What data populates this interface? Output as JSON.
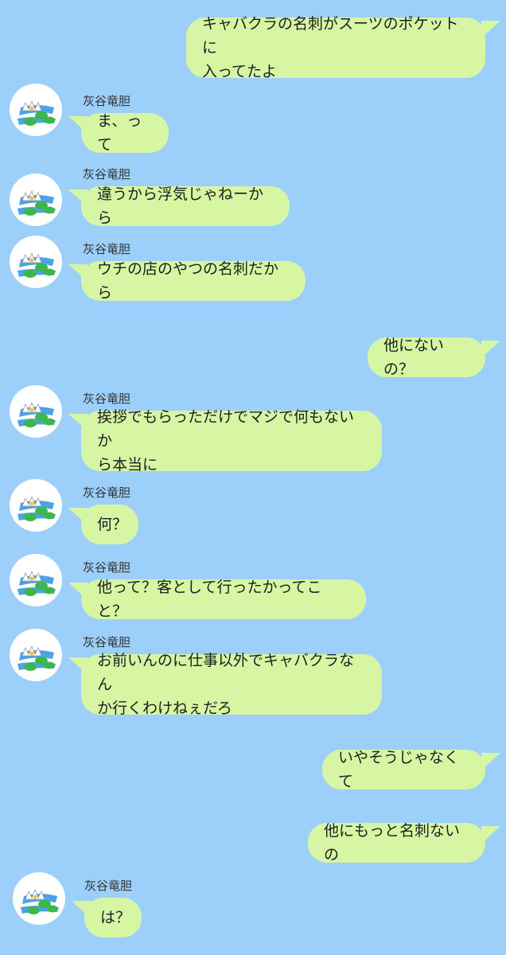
{
  "contact": {
    "name": "灰谷竜胆",
    "avatar_icon": "water-lily-icon"
  },
  "colors": {
    "background": "#9ccffa",
    "bubble": "#d6f6a4",
    "text": "#1e1e1e"
  },
  "messages": [
    {
      "side": "right",
      "text": "キャバクラの名刺がスーツのポケットに\n入ってたよ"
    },
    {
      "side": "left",
      "text": "ま、って"
    },
    {
      "side": "left",
      "text": "違うから浮気じゃねーから"
    },
    {
      "side": "left",
      "text": "ウチの店のやつの名刺だから"
    },
    {
      "side": "right",
      "text": "他にないの？"
    },
    {
      "side": "left",
      "text": "挨拶でもらっただけでマジで何もないか\nら本当に"
    },
    {
      "side": "left",
      "text": "何？"
    },
    {
      "side": "left",
      "text": "他って？客として行ったかってこと？"
    },
    {
      "side": "left",
      "text": "お前いんのに仕事以外でキャバクラなん\nか行くわけねぇだろ"
    },
    {
      "side": "right",
      "text": "いやそうじゃなくて"
    },
    {
      "side": "right",
      "text": "他にもっと名刺ないの"
    },
    {
      "side": "left",
      "text": "は？"
    }
  ]
}
